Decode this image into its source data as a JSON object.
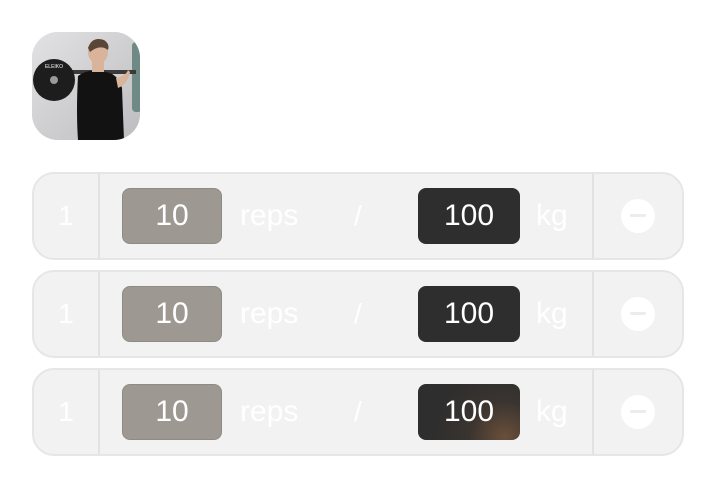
{
  "exercise": {
    "thumbnail_icon": "athlete-barbell-photo",
    "plate_text": "ELEIKO"
  },
  "sets": [
    {
      "index": "1",
      "reps": "10",
      "reps_unit": "reps",
      "separator": "/",
      "weight": "100",
      "weight_unit": "kg",
      "remove_icon": "minus-circle-icon"
    },
    {
      "index": "1",
      "reps": "10",
      "reps_unit": "reps",
      "separator": "/",
      "weight": "100",
      "weight_unit": "kg",
      "remove_icon": "minus-circle-icon"
    },
    {
      "index": "1",
      "reps": "10",
      "reps_unit": "reps",
      "separator": "/",
      "weight": "100",
      "weight_unit": "kg",
      "remove_icon": "minus-circle-icon"
    }
  ],
  "colors": {
    "row_bg": "#f2f2f2",
    "reps_box": "#9e9892",
    "weight_box": "#2e2e2e",
    "text": "#ffffff"
  }
}
